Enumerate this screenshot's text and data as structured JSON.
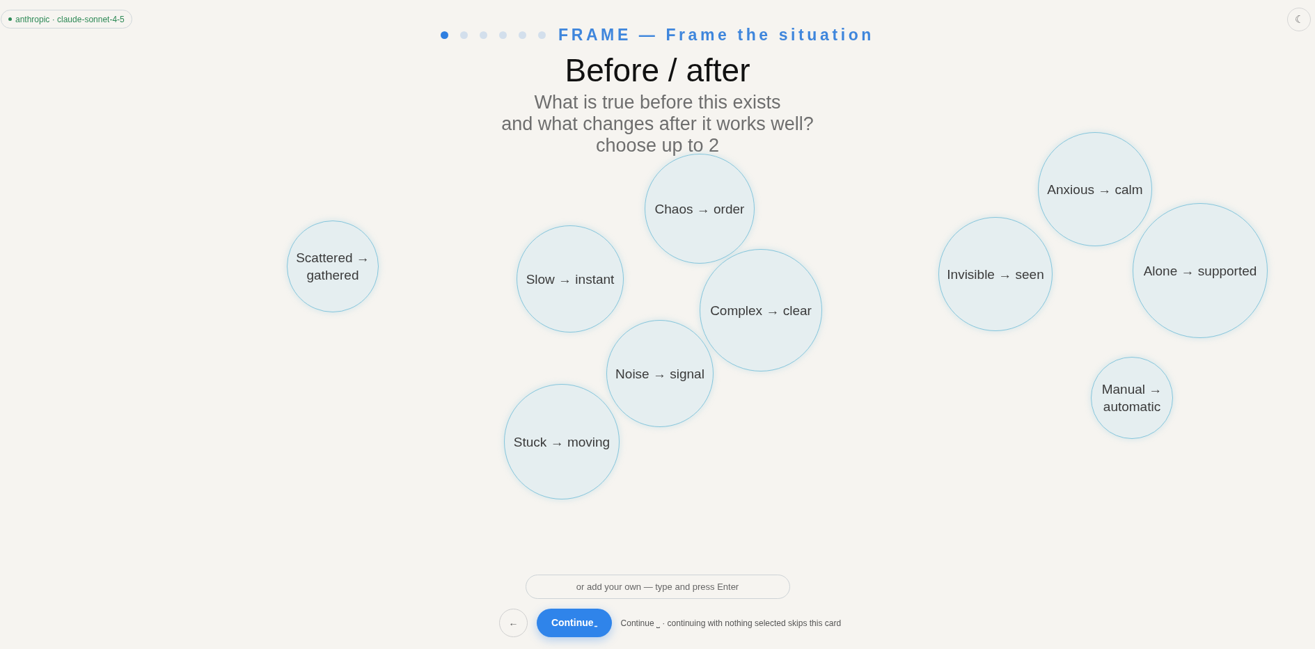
{
  "model_badge": {
    "label": "anthropic · claude-sonnet-4-5",
    "color": "#2f8a57"
  },
  "theme_toggle": {
    "glyph": "☾"
  },
  "progress": {
    "steps": [
      {
        "selected": true
      },
      {
        "selected": false
      },
      {
        "selected": false
      },
      {
        "selected": false
      },
      {
        "selected": false
      },
      {
        "selected": false
      }
    ]
  },
  "stage_label": "FRAME — Frame the situation",
  "title": "Before / after",
  "subtitle": [
    "What is true before this exists",
    "and what changes after it works well?",
    "choose up to 2"
  ],
  "bubbles": [
    {
      "label": "Chaos → order",
      "selected": false
    },
    {
      "label": "Anxious → calm",
      "selected": false
    },
    {
      "label": "Scattered → gathered",
      "selected": false
    },
    {
      "label": "Slow → instant",
      "selected": false
    },
    {
      "label": "Complex → clear",
      "selected": false
    },
    {
      "label": "Invisible → seen",
      "selected": false
    },
    {
      "label": "Alone → supported",
      "selected": false
    },
    {
      "label": "Noise → signal",
      "selected": false
    },
    {
      "label": "Manual → automatic",
      "selected": false
    },
    {
      "label": "Stuck → moving",
      "selected": false
    }
  ],
  "custom_input": {
    "placeholder": "or add your own — type and press Enter"
  },
  "back_button": {
    "glyph": "←"
  },
  "continue_button": {
    "label": "Continue",
    "key_hint": "⎵"
  },
  "hint": "Continue ⎵ · continuing with nothing selected skips this card"
}
